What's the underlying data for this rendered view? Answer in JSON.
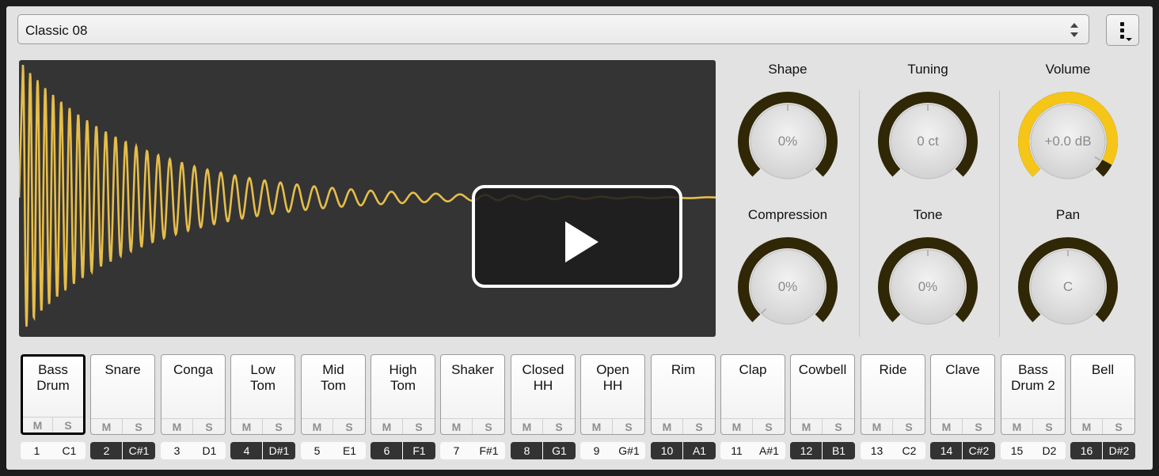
{
  "preset": {
    "name": "Classic 08"
  },
  "knobs": [
    {
      "label": "Shape",
      "value": "0%"
    },
    {
      "label": "Tuning",
      "value": "0 ct"
    },
    {
      "label": "Volume",
      "value": "+0.0 dB"
    },
    {
      "label": "Compression",
      "value": "0%"
    },
    {
      "label": "Tone",
      "value": "0%"
    },
    {
      "label": "Pan",
      "value": "C"
    }
  ],
  "colors": {
    "accent": "#f5c518",
    "ring": "#2f2706",
    "wave": "#e6bd4a"
  },
  "pad_labels": {
    "mute": "M",
    "solo": "S"
  },
  "pads": [
    {
      "name": "Bass\nDrum",
      "num": "1",
      "note": "C1"
    },
    {
      "name": "Snare",
      "num": "2",
      "note": "C#1"
    },
    {
      "name": "Conga",
      "num": "3",
      "note": "D1"
    },
    {
      "name": "Low\nTom",
      "num": "4",
      "note": "D#1"
    },
    {
      "name": "Mid\nTom",
      "num": "5",
      "note": "E1"
    },
    {
      "name": "High\nTom",
      "num": "6",
      "note": "F1"
    },
    {
      "name": "Shaker",
      "num": "7",
      "note": "F#1"
    },
    {
      "name": "Closed\nHH",
      "num": "8",
      "note": "G1"
    },
    {
      "name": "Open\nHH",
      "num": "9",
      "note": "G#1"
    },
    {
      "name": "Rim",
      "num": "10",
      "note": "A1"
    },
    {
      "name": "Clap",
      "num": "11",
      "note": "A#1"
    },
    {
      "name": "Cowbell",
      "num": "12",
      "note": "B1"
    },
    {
      "name": "Ride",
      "num": "13",
      "note": "C2"
    },
    {
      "name": "Clave",
      "num": "14",
      "note": "C#2"
    },
    {
      "name": "Bass\nDrum 2",
      "num": "15",
      "note": "D2"
    },
    {
      "name": "Bell",
      "num": "16",
      "note": "D#2"
    }
  ],
  "selected_pad": 0
}
